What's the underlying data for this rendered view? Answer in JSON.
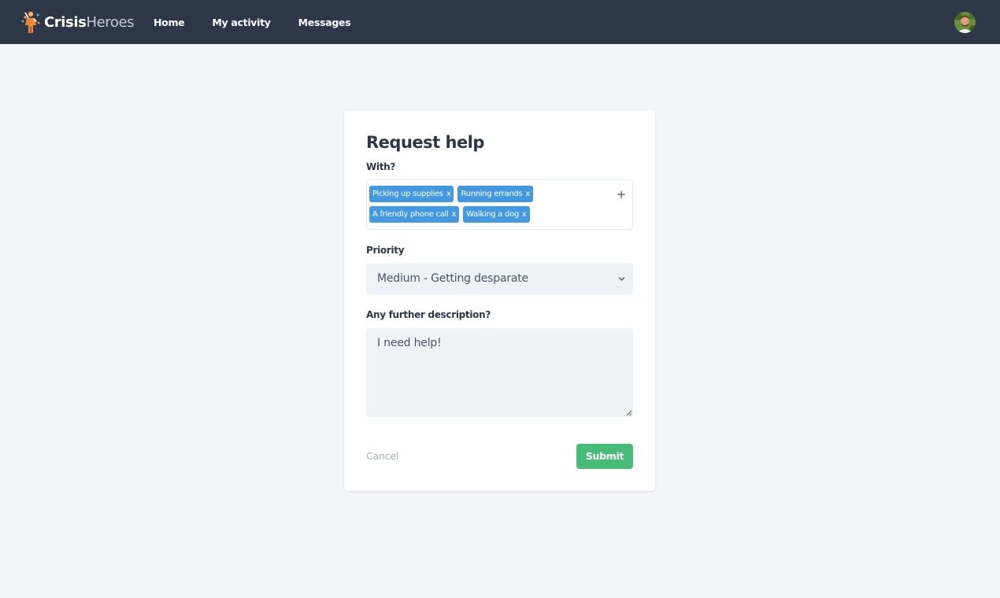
{
  "header": {
    "logo_bold": "Crisis",
    "logo_light": "Heroes",
    "nav": [
      {
        "label": "Home"
      },
      {
        "label": "My activity"
      },
      {
        "label": "Messages"
      }
    ]
  },
  "form": {
    "title": "Request help",
    "with_label": "With?",
    "tags": [
      {
        "label": "Picking up supplies",
        "remove": "x"
      },
      {
        "label": "Running errands",
        "remove": "x"
      },
      {
        "label": "A friendly phone call",
        "remove": "x"
      },
      {
        "label": "Walking a dog",
        "remove": "x"
      }
    ],
    "add_tag_symbol": "+",
    "priority_label": "Priority",
    "priority_value": "Medium - Getting desparate",
    "description_label": "Any further description?",
    "description_value": "I need help!",
    "cancel_label": "Cancel",
    "submit_label": "Submit"
  },
  "colors": {
    "header_bg": "#2d3748",
    "page_bg": "#f3f5f9",
    "tag_bg": "#4299e1",
    "submit_bg": "#48bb78",
    "field_bg": "#edf2f7"
  },
  "icons": {
    "logo": "hero-figure-icon",
    "avatar": "user-avatar",
    "add": "plus-icon",
    "select": "chevron-down-icon"
  }
}
